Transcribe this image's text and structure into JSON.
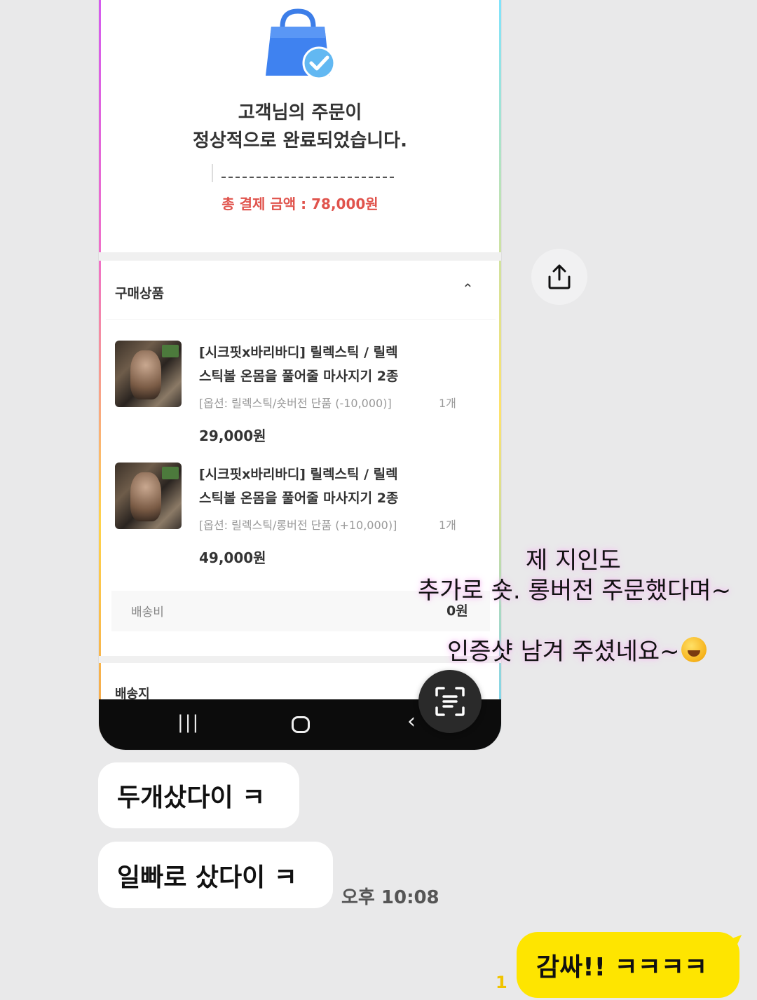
{
  "order_screenshot": {
    "complete_line1": "고객님의 주문이",
    "complete_line2": "정상적으로 완료되었습니다.",
    "total_payment": "총 결제 금액 : 78,000원",
    "purchased_section": "구매상품",
    "items": [
      {
        "name_line1": "[시크핏x바리바디] 릴렉스틱 / 릴렉",
        "name_line2": "스틱볼 온몸을 풀어줄 마사지기 2종",
        "option": "[옵션: 릴렉스틱/숏버전 단품 (-10,000)]",
        "qty": "1개",
        "price": "29,000원"
      },
      {
        "name_line1": "[시크핏x바리바디] 릴렉스틱 / 릴렉",
        "name_line2": "스틱볼 온몸을 풀어줄 마사지기 2종",
        "option": "[옵션: 릴렉스틱/롱버전 단품 (+10,000)]",
        "qty": "1개",
        "price": "49,000원"
      }
    ],
    "shipping_label": "배송비",
    "shipping_value": "0원",
    "next_section": "배송지"
  },
  "captions": {
    "line1": "제 지인도",
    "line2": "추가로 숏. 롱버전 주문했다며~",
    "line3": "인증샷 남겨 주셨네요~"
  },
  "chat": {
    "messages": [
      "두개샀다이 ㅋ",
      "일빠로 샀다이 ㅋ"
    ],
    "time": "오후 10:08",
    "my_message": "감싸!! ㅋㅋㅋㅋ",
    "unread_count": "1"
  },
  "icons": {
    "share": "share-icon",
    "scan": "text-scan-icon",
    "bag": "shopping-bag-check-icon"
  },
  "colors": {
    "my_bubble": "#fee500",
    "total_red": "#e0534c",
    "background": "#e9e9ea"
  }
}
